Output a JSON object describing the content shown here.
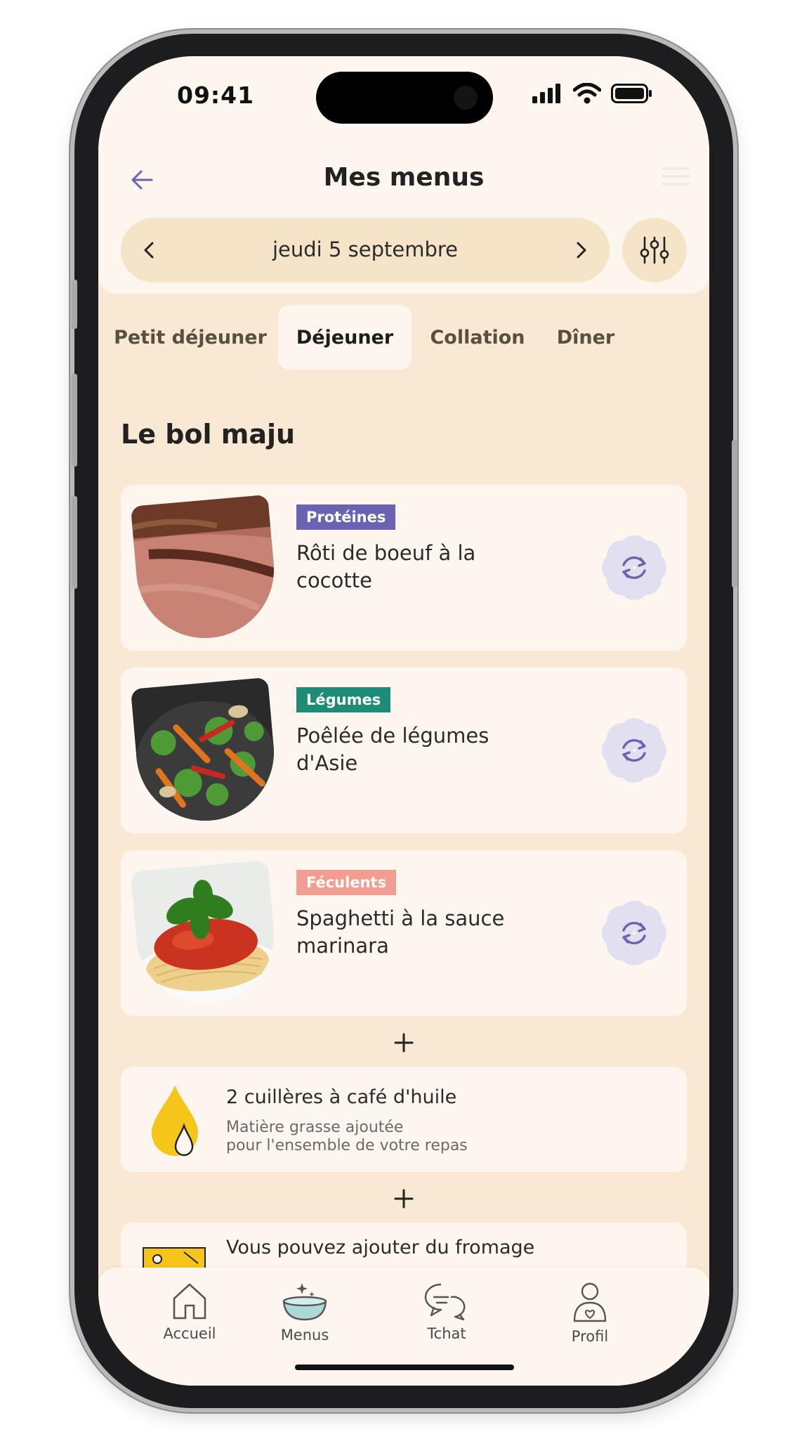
{
  "status_bar": {
    "time": "09:41"
  },
  "header": {
    "title": "Mes menus"
  },
  "date_nav": {
    "date": "jeudi 5 septembre"
  },
  "meal_tabs": [
    {
      "label": "Petit déjeuner",
      "active": false
    },
    {
      "label": "Déjeuner",
      "active": true
    },
    {
      "label": "Collation",
      "active": false
    },
    {
      "label": "Dîner",
      "active": false
    }
  ],
  "section": {
    "title": "Le bol maju"
  },
  "items": [
    {
      "badge": "Protéines",
      "badge_color": "#6a63b3",
      "title": "Rôti de boeuf à la cocotte",
      "image_icon": "roast-beef-photo"
    },
    {
      "badge": "Légumes",
      "badge_color": "#1f8b77",
      "title": "Poêlée de légumes d'Asie",
      "image_icon": "stir-fry-vegetables-photo"
    },
    {
      "badge": "Féculents",
      "badge_color": "#f19d92",
      "title": "Spaghetti à la sauce marinara",
      "image_icon": "spaghetti-marinara-photo"
    }
  ],
  "oil": {
    "title": "2 cuillères à café d'huile",
    "subtitle_line1": "Matière grasse ajoutée",
    "subtitle_line2": "pour l'ensemble de votre repas",
    "icon": "oil-drop-icon"
  },
  "cheese": {
    "title": "Vous pouvez ajouter du fromage",
    "icon": "cheese-icon"
  },
  "tabbar": [
    {
      "label": "Accueil",
      "icon": "home-icon"
    },
    {
      "label": "Menus",
      "icon": "bowl-icon"
    },
    {
      "label": "Tchat",
      "icon": "chat-icon"
    },
    {
      "label": "Profil",
      "icon": "profile-icon"
    }
  ],
  "colors": {
    "background": "#f9e8d3",
    "surface": "#fdf6ef",
    "accent": "#6a63b3",
    "oil_yellow": "#f6c51a"
  }
}
